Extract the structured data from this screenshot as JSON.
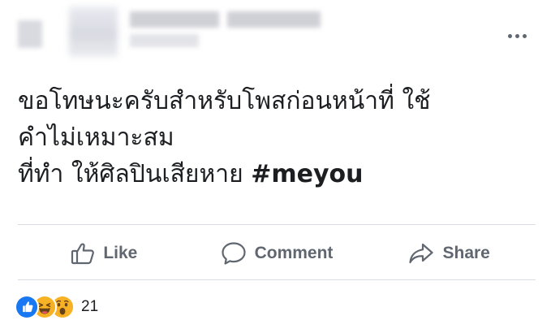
{
  "post": {
    "body_lines": [
      "ขอโทษนะครับสำหรับโพสก่อนหน้าที่ ใช้",
      "คำไม่เหมาะสม",
      "ที่ทำ ให้ศิลปินเสียหาย "
    ],
    "hashtag": "#meyou"
  },
  "actions": {
    "like_label": "Like",
    "comment_label": "Comment",
    "share_label": "Share"
  },
  "reactions": {
    "icons": [
      "like-reaction-icon",
      "haha-reaction-icon",
      "wow-reaction-icon"
    ],
    "count": "21"
  },
  "colors": {
    "text": "#1c1e21",
    "secondary_text": "#606770",
    "divider": "#dadde1",
    "like_blue": "#1877f2",
    "reaction_yellow": "#f7b125"
  }
}
